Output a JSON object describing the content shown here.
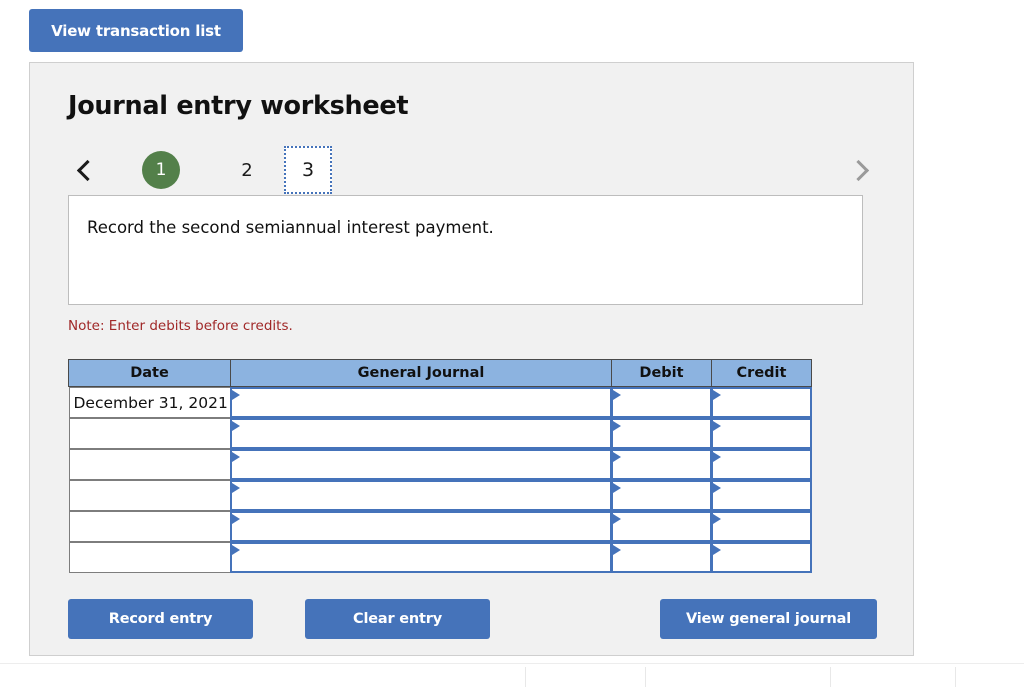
{
  "toolbar": {
    "view_transaction_list_label": "View transaction list"
  },
  "card": {
    "title": "Journal entry worksheet"
  },
  "pager": {
    "prev_icon": "chevron-left-icon",
    "next_icon": "chevron-right-icon",
    "steps": [
      {
        "label": "1",
        "state": "completed"
      },
      {
        "label": "2",
        "state": "default"
      },
      {
        "label": "3",
        "state": "active"
      }
    ]
  },
  "description": {
    "text": "Record the second semiannual interest payment."
  },
  "note": {
    "text": "Note: Enter debits before credits."
  },
  "table": {
    "headers": {
      "date": "Date",
      "general_journal": "General Journal",
      "debit": "Debit",
      "credit": "Credit"
    },
    "rows": [
      {
        "date": "December 31, 2021",
        "general_journal": "",
        "debit": "",
        "credit": ""
      },
      {
        "date": "",
        "general_journal": "",
        "debit": "",
        "credit": ""
      },
      {
        "date": "",
        "general_journal": "",
        "debit": "",
        "credit": ""
      },
      {
        "date": "",
        "general_journal": "",
        "debit": "",
        "credit": ""
      },
      {
        "date": "",
        "general_journal": "",
        "debit": "",
        "credit": ""
      },
      {
        "date": "",
        "general_journal": "",
        "debit": "",
        "credit": ""
      }
    ]
  },
  "actions": {
    "record_entry_label": "Record entry",
    "clear_entry_label": "Clear entry",
    "view_general_journal_label": "View general journal"
  },
  "colors": {
    "accent_blue": "#4573ba",
    "header_blue": "#8cb3e0",
    "completed_green": "#53804a",
    "note_red": "#a02828",
    "card_bg": "#f1f1f1"
  }
}
